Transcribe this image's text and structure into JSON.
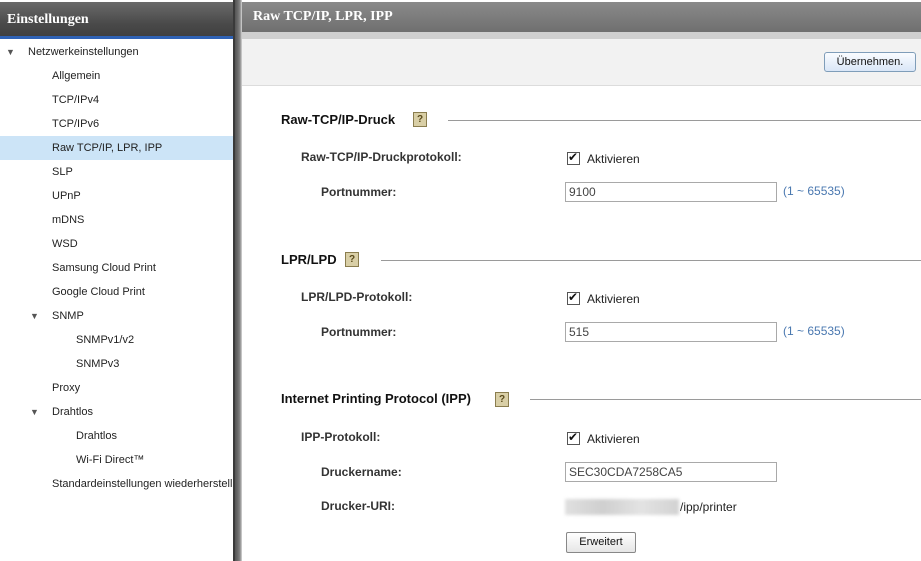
{
  "sidebar": {
    "title": "Einstellungen",
    "items": [
      {
        "label": "Netzwerkeinstellungen",
        "level": 0,
        "expanded": true
      },
      {
        "label": "Allgemein",
        "level": 1
      },
      {
        "label": "TCP/IPv4",
        "level": 1
      },
      {
        "label": "TCP/IPv6",
        "level": 1
      },
      {
        "label": "Raw TCP/IP, LPR, IPP",
        "level": 1,
        "selected": true
      },
      {
        "label": "SLP",
        "level": 1
      },
      {
        "label": "UPnP",
        "level": 1
      },
      {
        "label": "mDNS",
        "level": 1
      },
      {
        "label": "WSD",
        "level": 1
      },
      {
        "label": "Samsung Cloud Print",
        "level": 1
      },
      {
        "label": "Google Cloud Print",
        "level": 1
      },
      {
        "label": "SNMP",
        "level": 1,
        "expanded": true
      },
      {
        "label": "SNMPv1/v2",
        "level": 2
      },
      {
        "label": "SNMPv3",
        "level": 2
      },
      {
        "label": "Proxy",
        "level": 1
      },
      {
        "label": "Drahtlos",
        "level": 1,
        "expanded": true
      },
      {
        "label": "Drahtlos",
        "level": 2
      },
      {
        "label": "Wi-Fi Direct™",
        "level": 2
      },
      {
        "label": "Standardeinstellungen wiederherstell",
        "level": 1
      }
    ]
  },
  "header": {
    "title": "Raw TCP/IP, LPR, IPP"
  },
  "toolbar": {
    "apply_label": "Übernehmen."
  },
  "raw": {
    "title": "Raw-TCP/IP-Druck",
    "help": "?",
    "protocol_label": "Raw-TCP/IP-Druckprotokoll:",
    "enable_label": "Aktivieren",
    "enabled": true,
    "port_label": "Portnummer:",
    "port_value": "9100",
    "port_range": "(1 ~ 65535)"
  },
  "lpr": {
    "title": "LPR/LPD",
    "help": "?",
    "protocol_label": "LPR/LPD-Protokoll:",
    "enable_label": "Aktivieren",
    "enabled": true,
    "port_label": "Portnummer:",
    "port_value": "515",
    "port_range": "(1 ~ 65535)"
  },
  "ipp": {
    "title": "Internet Printing Protocol (IPP)",
    "help": "?",
    "protocol_label": "IPP-Protokoll:",
    "enable_label": "Aktivieren",
    "enabled": true,
    "name_label": "Druckername:",
    "name_value": "SEC30CDA7258CA5",
    "uri_label": "Drucker-URI:",
    "uri_suffix": "/ipp/printer",
    "advanced_label": "Erweitert"
  },
  "colors": {
    "selected_bg": "#cce4f7",
    "header_accent": "#2f62b5",
    "range_text": "#4a78b0"
  }
}
